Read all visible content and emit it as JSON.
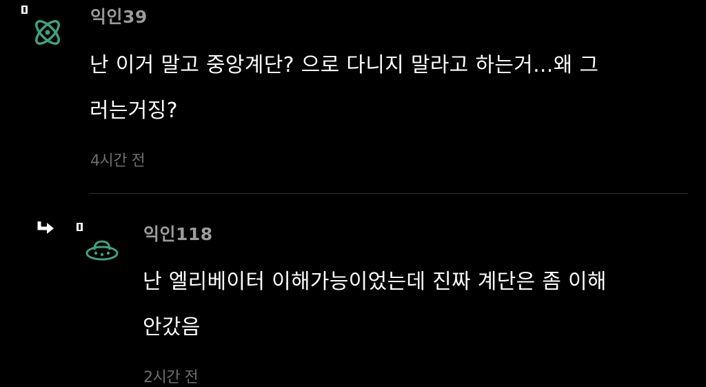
{
  "comments": [
    {
      "username": "익인39",
      "text_line1": "난 이거 말고 중앙계단? 으로 다니지 말라고 하는거...왜 그",
      "text_line2": "러는거징?",
      "time": "4시간 전",
      "avatar_icon": "atom-icon",
      "avatar_color": "#3fa27f"
    },
    {
      "username": "익인118",
      "text_line1": "난 엘리베이터 이해가능이었는데 진짜 계단은 좀 이해",
      "text_line2": "안갔음",
      "time": "2시간 전",
      "avatar_icon": "ufo-icon",
      "avatar_color": "#3fa27f",
      "reply_icon": "reply-arrow-icon"
    }
  ],
  "colors": {
    "background": "#000000",
    "username": "#9b9b9b",
    "text": "#ffffff",
    "timestamp": "#6e6e6e",
    "divider": "#2e2e2e",
    "accent": "#3fa27f"
  }
}
